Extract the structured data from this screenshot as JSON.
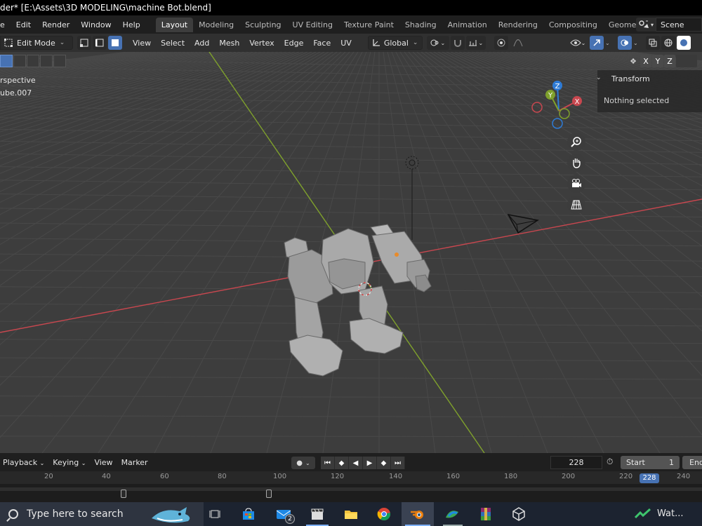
{
  "window": {
    "title": "der* [E:\\Assets\\3D MODELING\\machine Bot.blend]"
  },
  "menu": {
    "items": [
      "e",
      "Edit",
      "Render",
      "Window",
      "Help"
    ]
  },
  "workspaces": {
    "tabs": [
      "Layout",
      "Modeling",
      "Sculpting",
      "UV Editing",
      "Texture Paint",
      "Shading",
      "Animation",
      "Rendering",
      "Compositing",
      "Geometry Noc"
    ],
    "active": "Layout"
  },
  "scene": {
    "label": "Scene"
  },
  "viewport_header": {
    "mode": "Edit Mode",
    "menus": [
      "View",
      "Select",
      "Add",
      "Mesh",
      "Vertex",
      "Edge",
      "Face",
      "UV"
    ],
    "orientation": "Global"
  },
  "axis_toggles": [
    "X",
    "Y",
    "Z"
  ],
  "viewport": {
    "view_label": "rspective",
    "object_label": "ube.007",
    "axis_colors": {
      "x": "#c8474f",
      "y": "#7fa12c",
      "z": "#2e7bd6"
    },
    "gizmo_labels": {
      "x": "X",
      "y": "Y",
      "z": "Z"
    }
  },
  "npanel": {
    "title": "Transform",
    "message": "Nothing selected"
  },
  "timeline": {
    "menus": [
      "Playback",
      "Keying",
      "View",
      "Marker"
    ],
    "current_frame": "228",
    "start_label": "Start",
    "start_value": "1",
    "end_label": "End",
    "ruler_ticks": [
      "20",
      "40",
      "60",
      "80",
      "100",
      "120",
      "140",
      "160",
      "180",
      "200",
      "220",
      "240"
    ],
    "playhead": "228"
  },
  "taskbar": {
    "search_placeholder": "Type here to search",
    "mail_badge": "2",
    "weather_text": "Wat..."
  },
  "icons": [
    "search-icon",
    "task-view-icon",
    "store-icon",
    "mail-icon",
    "clapper-icon",
    "folder-icon",
    "chrome-icon",
    "blender-icon",
    "photos-icon",
    "winrar-icon",
    "unity-icon",
    "stocks-icon"
  ]
}
